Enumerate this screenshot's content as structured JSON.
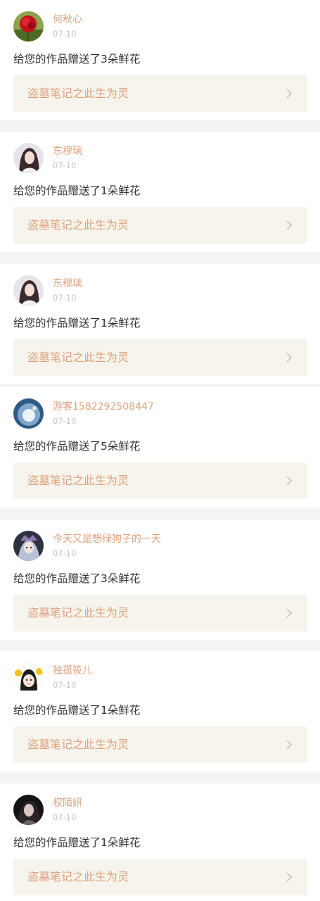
{
  "notifications": [
    {
      "username": "何秋心",
      "date": "07-10",
      "message": "给您的作品赠送了3朵鲜花",
      "work_title": "盗墓笔记之此生为灵",
      "avatar_icon": "red-rose-avatar-icon"
    },
    {
      "username": "东穆璃",
      "date": "07-10",
      "message": "给您的作品赠送了1朵鲜花",
      "work_title": "盗墓笔记之此生为灵",
      "avatar_icon": "girl-portrait-avatar-icon"
    },
    {
      "username": "东穆璃",
      "date": "07-10",
      "message": "给您的作品赠送了1朵鲜花",
      "work_title": "盗墓笔记之此生为灵",
      "avatar_icon": "girl-portrait-avatar-icon"
    },
    {
      "username": "游客1582292508447",
      "date": "07-10",
      "message": "给您的作品赠送了5朵鲜花",
      "work_title": "盗墓笔记之此生为灵",
      "avatar_icon": "blue-sky-avatar-icon"
    },
    {
      "username": "今天又是想绿狗子的一天",
      "date": "07-10",
      "message": "给您的作品赠送了3朵鲜花",
      "work_title": "盗墓笔记之此生为灵",
      "avatar_icon": "anime-character-avatar-icon"
    },
    {
      "username": "独孤筱儿",
      "date": "07-10",
      "message": "给您的作品赠送了1朵鲜花",
      "work_title": "盗墓笔记之此生为灵",
      "avatar_icon": "cartoon-girl-avatar-icon"
    },
    {
      "username": "权陌妍",
      "date": "07-10",
      "message": "给您的作品赠送了1朵鲜花",
      "work_title": "盗墓笔记之此生为灵",
      "avatar_icon": "dark-portrait-avatar-icon"
    }
  ],
  "colors": {
    "accent": "#e0a27e",
    "link_background": "#f6f4ec",
    "page_background": "#f5f4f2"
  }
}
